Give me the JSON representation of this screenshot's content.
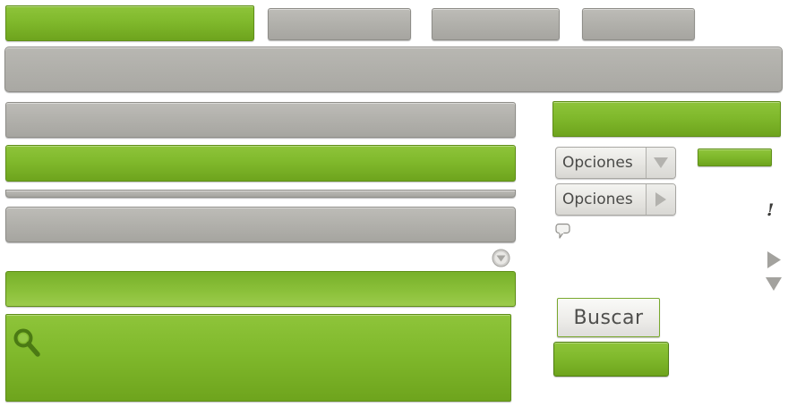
{
  "window": {
    "options_dropdown_label": "Opciones",
    "options_submenu_label": "Opciones",
    "search_button_label": "Buscar",
    "alert_glyph": "!"
  },
  "colors": {
    "accent_green": "#80b92c",
    "neutral_grey": "#b1b0ab",
    "text_dark": "#4a4a48"
  },
  "icons": {
    "search": "magnifier-icon",
    "dropdown": "triangle-down-icon",
    "submenu": "triangle-right-icon",
    "comment": "speech-bubble-icon",
    "alert": "exclamation-icon",
    "circle_down": "circle-arrow-down-icon"
  }
}
